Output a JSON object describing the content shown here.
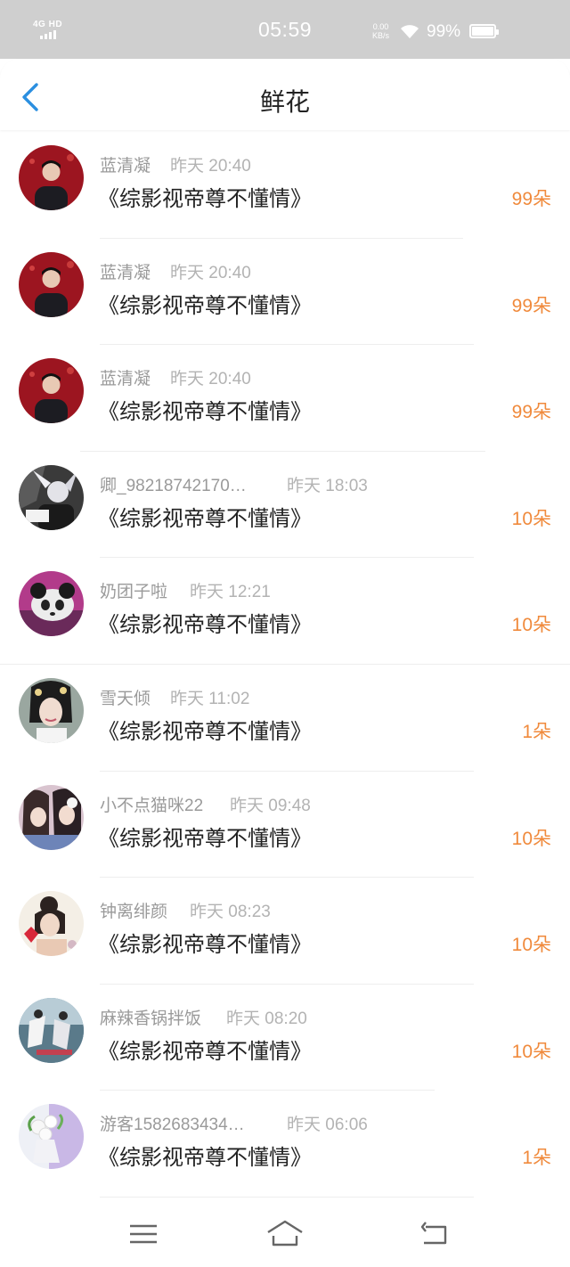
{
  "status_bar": {
    "network": "4G HD",
    "time": "05:59",
    "net_speed": "0.00",
    "net_speed_unit": "KB/s",
    "battery": "99%"
  },
  "header": {
    "title": "鲜花",
    "back_icon": "chevron-left-icon"
  },
  "rows": [
    {
      "user": "蓝清凝",
      "time": "昨天 20:40",
      "book": "《综影视帝尊不懂情》",
      "amount": "99朵"
    },
    {
      "user": "蓝清凝",
      "time": "昨天 20:40",
      "book": "《综影视帝尊不懂情》",
      "amount": "99朵"
    },
    {
      "user": "蓝清凝",
      "time": "昨天 20:40",
      "book": "《综影视帝尊不懂情》",
      "amount": "99朵"
    },
    {
      "user": "卿_98218742170…",
      "time": "昨天 18:03",
      "book": "《综影视帝尊不懂情》",
      "amount": "10朵"
    },
    {
      "user": "奶团子啦",
      "time": "昨天 12:21",
      "book": "《综影视帝尊不懂情》",
      "amount": "10朵"
    },
    {
      "user": "雪天倾",
      "time": "昨天 11:02",
      "book": "《综影视帝尊不懂情》",
      "amount": "1朵"
    },
    {
      "user": "小不点猫咪22",
      "time": "昨天 09:48",
      "book": "《综影视帝尊不懂情》",
      "amount": "10朵"
    },
    {
      "user": "钟离绯颜",
      "time": "昨天 08:23",
      "book": "《综影视帝尊不懂情》",
      "amount": "10朵"
    },
    {
      "user": "麻辣香锅拌饭",
      "time": "昨天 08:20",
      "book": "《综影视帝尊不懂情》",
      "amount": "10朵"
    },
    {
      "user": "游客1582683434…",
      "time": "昨天 06:06",
      "book": "《综影视帝尊不懂情》",
      "amount": "1朵"
    }
  ],
  "nav": {
    "menu_icon": "menu-icon",
    "home_icon": "home-icon",
    "back_icon": "return-icon"
  },
  "colors": {
    "accent": "#f08a3c",
    "back_arrow": "#2b8fe0",
    "status_bar_bg": "#cfcfcf"
  }
}
